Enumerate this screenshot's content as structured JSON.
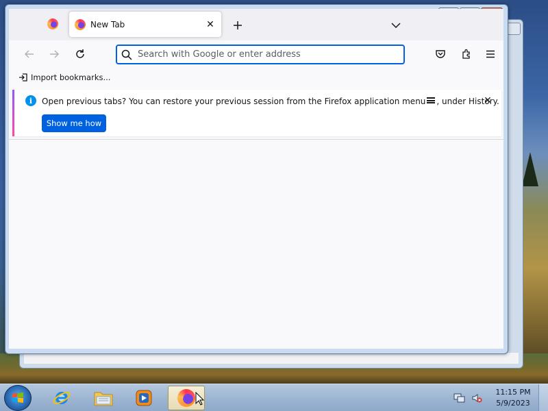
{
  "browser": {
    "tabs": [
      {
        "label": "",
        "pinned": true,
        "icon": "firefox-icon"
      },
      {
        "label": "New Tab",
        "active": true,
        "icon": "firefox-icon"
      }
    ],
    "urlbar": {
      "placeholder": "Search with Google or enter address",
      "value": ""
    },
    "bookmarks": {
      "import_label": "Import bookmarks..."
    },
    "notification": {
      "text_before": "Open previous tabs? You can restore your previous session from the Firefox application menu",
      "text_after": ", under History.",
      "button_label": "Show me how"
    }
  },
  "window_controls": {
    "minimize": "minimize-icon",
    "maximize": "maximize-icon",
    "close": "close-icon"
  },
  "taskbar": {
    "items": [
      {
        "name": "internet-explorer",
        "icon": "ie-icon"
      },
      {
        "name": "file-explorer",
        "icon": "folder-icon"
      },
      {
        "name": "media-player",
        "icon": "media-player-icon"
      },
      {
        "name": "firefox",
        "icon": "firefox-icon",
        "active": true
      }
    ],
    "clock": {
      "time": "11:15 PM",
      "date": "5/9/2023"
    }
  },
  "colors": {
    "accent": "#0061e0",
    "info": "#0090ed",
    "notification_bar_gradient": [
      "#9059ff",
      "#ff4aa2"
    ]
  }
}
